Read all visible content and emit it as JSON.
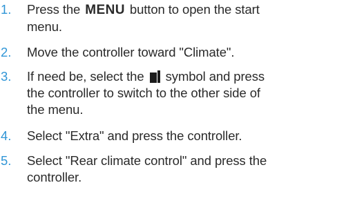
{
  "steps": [
    {
      "number": "1.",
      "text_before": "Press the",
      "key": "MENU",
      "text_after": "button to open the start",
      "line2": "menu."
    },
    {
      "number": "2.",
      "line1": "Move the controller toward \"Climate\"."
    },
    {
      "number": "3.",
      "text_before": "If need be, select the",
      "icon": "menu-side-switch-icon",
      "text_after": "symbol and press",
      "line2": "the controller to switch to the other side of",
      "line3": "the menu."
    },
    {
      "number": "4.",
      "line1": "Select \"Extra\" and press the controller."
    },
    {
      "number": "5.",
      "line1": "Select \"Rear climate control\" and press the",
      "line2": "controller."
    }
  ],
  "colors": {
    "step_number": "#2f95d6",
    "text": "#2a2a2a"
  }
}
